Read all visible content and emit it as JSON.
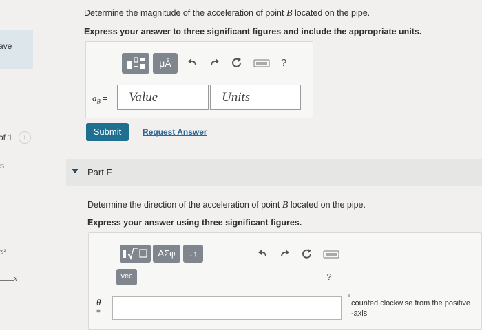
{
  "sidebar": {
    "top_label": "ave",
    "page_fraction": "of 1",
    "next_arrow": "chevron-right-icon",
    "s_label": "s",
    "unit_label": "/s²",
    "axis_label": "x"
  },
  "part_e": {
    "question_prefix": "Determine the magnitude of the acceleration of point",
    "question_var": "B",
    "question_suffix": "located on the pipe.",
    "instruction": "Express your answer to three significant figures and include the appropriate units.",
    "toolbar": {
      "mu_label": "μÅ",
      "help_label": "?"
    },
    "var_label": "aB =",
    "var_main": "a",
    "var_sub": "B",
    "var_eq": "=",
    "value_placeholder": "Value",
    "units_placeholder": "Units",
    "submit_label": "Submit",
    "request_label": "Request Answer"
  },
  "part_f": {
    "header": "Part F",
    "question_prefix": "Determine the direction of the acceleration of point",
    "question_var": "B",
    "question_suffix": "located on the pipe.",
    "instruction": "Express your answer using three significant figures.",
    "toolbar": {
      "greek_label": "ΑΣφ",
      "sort_label": "↓↑",
      "vec_label": "vec",
      "help_label": "?"
    },
    "theta_label": "θ",
    "eq_label": "=",
    "input_value": "",
    "degree_symbol": "°",
    "direction_text": "counted clockwise from the positive",
    "axis_text": "-axis"
  },
  "colors": {
    "accent": "#1f6f91",
    "link": "#2b6896",
    "toolbar_button": "#7f868e"
  }
}
